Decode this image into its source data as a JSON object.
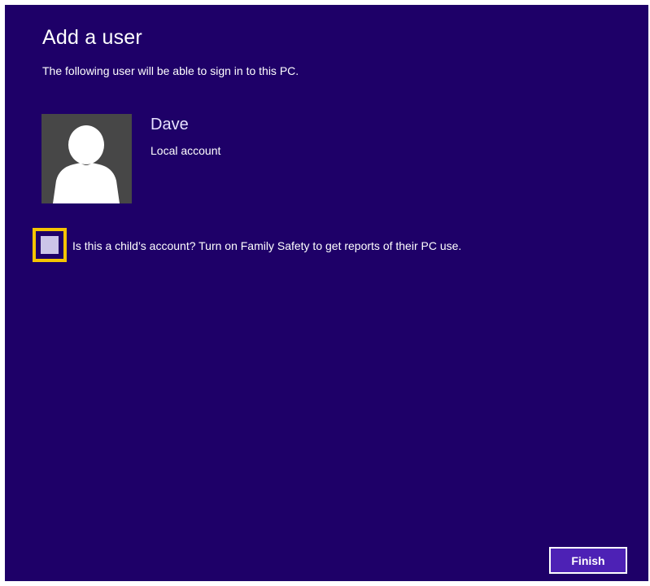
{
  "header": {
    "title": "Add a user",
    "subtitle": "The following user will be able to sign in to this PC."
  },
  "user": {
    "avatar_icon": "user-silhouette-icon",
    "name": "Dave",
    "account_type": "Local account"
  },
  "child_account": {
    "checked": false,
    "label": "Is this a child’s account? Turn on Family Safety to get reports of their PC use."
  },
  "actions": {
    "finish_label": "Finish"
  },
  "colors": {
    "background": "#1e0068",
    "focus_outline": "#f5c400",
    "button": "#4d21b5",
    "avatar_background": "#474747"
  }
}
